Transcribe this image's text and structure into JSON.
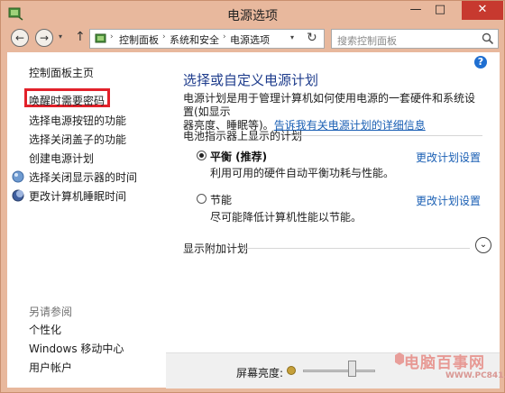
{
  "window": {
    "title": "电源选项",
    "min_label": "—",
    "max_label": "□",
    "close_label": "✕"
  },
  "nav": {
    "back_label": "←",
    "forward_label": "→",
    "dropdown_label": "▾",
    "up_label": "↑",
    "breadcrumbs": [
      "控制面板",
      "系统和安全",
      "电源选项"
    ],
    "breadcrumb_separator": "›",
    "refresh_label": "↻",
    "search_placeholder": "搜索控制面板"
  },
  "sidebar": {
    "items": [
      {
        "label": "控制面板主页"
      },
      {
        "label": "唤醒时需要密码"
      },
      {
        "label": "选择电源按钮的功能"
      },
      {
        "label": "选择关闭盖子的功能"
      },
      {
        "label": "创建电源计划"
      },
      {
        "label": "选择关闭显示器的时间"
      },
      {
        "label": "更改计算机睡眠时间"
      }
    ],
    "see_also_title": "另请参阅",
    "see_also": [
      {
        "label": "个性化"
      },
      {
        "label": "Windows 移动中心"
      },
      {
        "label": "用户帐户"
      }
    ]
  },
  "main": {
    "help_label": "?",
    "title": "选择或自定义电源计划",
    "intro_line1": "电源计划是用于管理计算机如何使用电源的一套硬件和系统设置(如显示",
    "intro_line2_prefix": "器亮度、睡眠等)。",
    "intro_link": "告诉我有关电源计划的详细信息",
    "section_title": "电池指示器上显示的计划",
    "plans": [
      {
        "name": "平衡 (推荐)",
        "desc": "利用可用的硬件自动平衡功耗与性能。",
        "link": "更改计划设置",
        "selected": true
      },
      {
        "name": "节能",
        "desc": "尽可能降低计算机性能以节能。",
        "link": "更改计划设置",
        "selected": false
      }
    ],
    "additional_label": "显示附加计划",
    "expand_label": "⌄"
  },
  "footer": {
    "brightness_label": "屏幕亮度:",
    "brightness_level": 0.7
  },
  "watermark": {
    "text": "电脑百事网",
    "sub": "WWW.PC841.COM"
  }
}
